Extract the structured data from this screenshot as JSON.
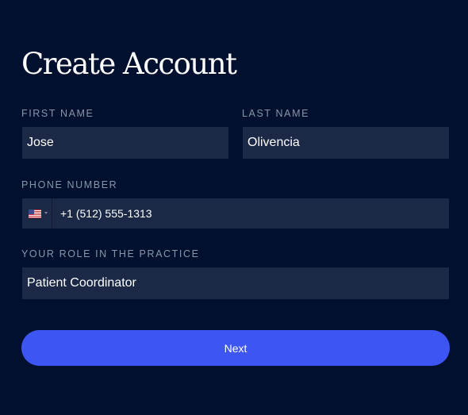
{
  "title": "Create Account",
  "form": {
    "first_name": {
      "label": "FIRST NAME",
      "value": "Jose"
    },
    "last_name": {
      "label": "LAST NAME",
      "value": "Olivencia"
    },
    "phone": {
      "label": "PHONE NUMBER",
      "country_flag": "us-flag-icon",
      "value": "+1 (512) 555-1313"
    },
    "role": {
      "label": "YOUR ROLE IN THE PRACTICE",
      "value": "Patient Coordinator"
    }
  },
  "next_button": {
    "label": "Next"
  },
  "colors": {
    "background": "#02102f",
    "field_background": "#1b2846",
    "label": "#8c94a8",
    "accent": "#3d55f2",
    "text": "#ffffff"
  }
}
